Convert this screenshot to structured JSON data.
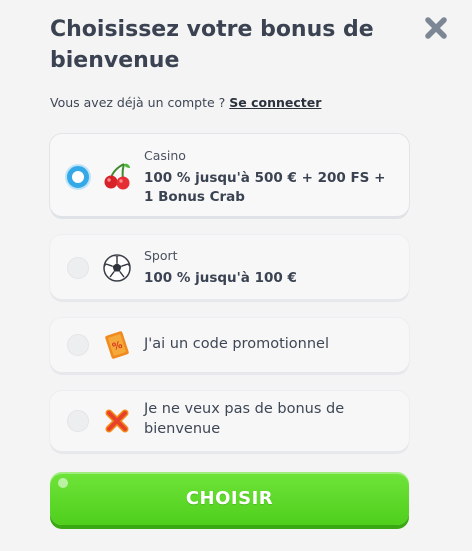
{
  "modal": {
    "title": "Choisissez votre bonus de bienvenue",
    "account_prompt": "Vous avez déjà un compte ?",
    "login_link": "Se connecter"
  },
  "options": [
    {
      "category": "Casino",
      "offer": "100 % jusqu'à 500 € + 200 FS + 1 Bonus Crab",
      "icon": "cherries-icon",
      "selected": true
    },
    {
      "category": "Sport",
      "offer": "100 % jusqu'à 100 €",
      "icon": "soccer-ball-icon",
      "selected": false
    },
    {
      "label": "J'ai un code promotionnel",
      "icon": "promo-ticket-icon",
      "selected": false
    },
    {
      "label": "Je ne veux pas de bonus de bienvenue",
      "icon": "cross-icon",
      "selected": false
    }
  ],
  "cta": {
    "label": "CHOISIR"
  },
  "colors": {
    "accent": "#35a9e8",
    "cta_green": "#58d524",
    "text": "#3b4352",
    "close": "#7d8694"
  }
}
